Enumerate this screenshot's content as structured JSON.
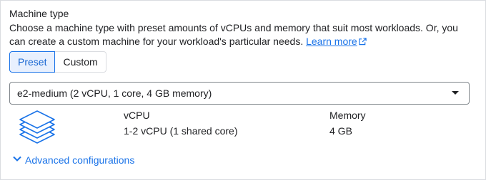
{
  "section": {
    "title": "Machine type",
    "description": "Choose a machine type with preset amounts of vCPUs and memory that suit most workloads. Or, you can create a custom machine for your workload's particular needs.",
    "learn_more": "Learn more"
  },
  "toggle": {
    "options": [
      "Preset",
      "Custom"
    ],
    "selected": "Preset"
  },
  "machine_select": {
    "value": "e2-medium (2 vCPU, 1 core, 4 GB memory)"
  },
  "specs": {
    "vcpu_label": "vCPU",
    "vcpu_value": "1-2 vCPU (1 shared core)",
    "memory_label": "Memory",
    "memory_value": "4 GB"
  },
  "advanced": {
    "label": "Advanced configurations"
  },
  "colors": {
    "accent": "#1a73e8",
    "selected_bg": "#e8f0fe",
    "border": "#dadce0"
  },
  "icons": [
    "open-in-new-icon",
    "dropdown-arrow-icon",
    "machine-stack-icon",
    "chevron-down-icon"
  ]
}
